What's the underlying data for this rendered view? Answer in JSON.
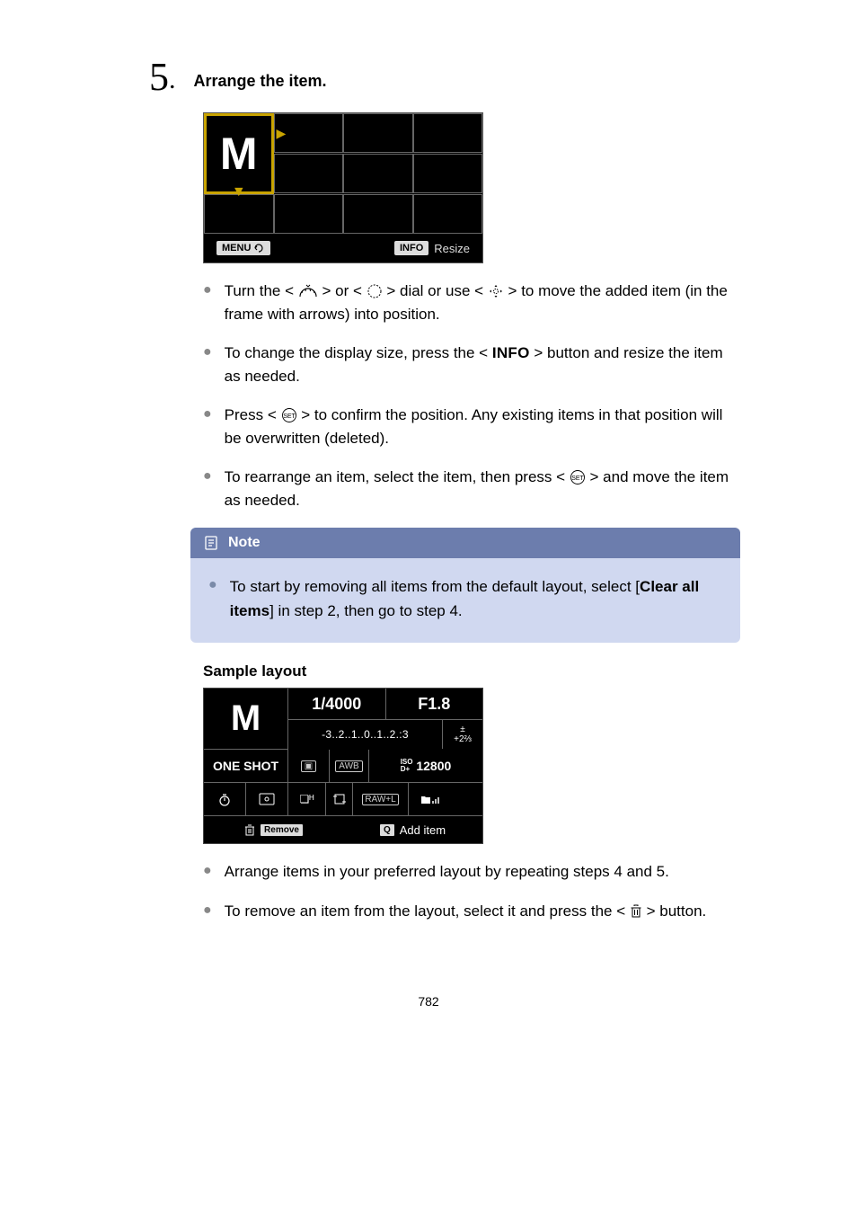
{
  "step": {
    "number": "5",
    "title": "Arrange the item."
  },
  "screen1": {
    "m_label": "M",
    "menu_label": "MENU",
    "info_label": "INFO",
    "resize_label": "Resize"
  },
  "bullets": [
    {
      "pre": "Turn the < ",
      "icon1": "main-dial",
      "mid1": " > or < ",
      "icon2": "quick-dial",
      "mid2": " > dial or use < ",
      "icon3": "multi-controller",
      "post": " > to move the added item (in the frame with arrows) into position."
    },
    {
      "pre": "To change the display size, press the < ",
      "info": "INFO",
      "post": " > button and resize the item as needed."
    },
    {
      "pre": "Press < ",
      "icon": "set-button",
      "post": " > to confirm the position. Any existing items in that position will be overwritten (deleted)."
    },
    {
      "pre": "To rearrange an item, select the item, then press < ",
      "icon": "set-button",
      "post": " > and move the item as needed."
    }
  ],
  "note": {
    "header": "Note",
    "body_pre": "To start by removing all items from the default layout, select [",
    "body_bold": "Clear all items",
    "body_post": "] in step 2, then go to step 4."
  },
  "sample_label": "Sample layout",
  "sample": {
    "m": "M",
    "tv": "1/4000",
    "av": "F1.8",
    "scale": "-3..2..1..0..1..2.:3",
    "comp_top": "±",
    "comp_bot": "+2⅔",
    "oneshot": "ONE SHOT",
    "awb": "AWB",
    "iso_pre": "ISO",
    "iso_mid": "D+",
    "iso_val": "12800",
    "dh": "❏ᴴ",
    "raw": "RAW+L",
    "remove_label": "Remove",
    "add_label": "Add item"
  },
  "bullets2": [
    {
      "text": "Arrange items in your preferred layout by repeating steps 4 and 5."
    },
    {
      "pre": "To remove an item from the layout, select it and press the < ",
      "icon": "trash-icon",
      "post": " > button."
    }
  ],
  "page_number": "782"
}
